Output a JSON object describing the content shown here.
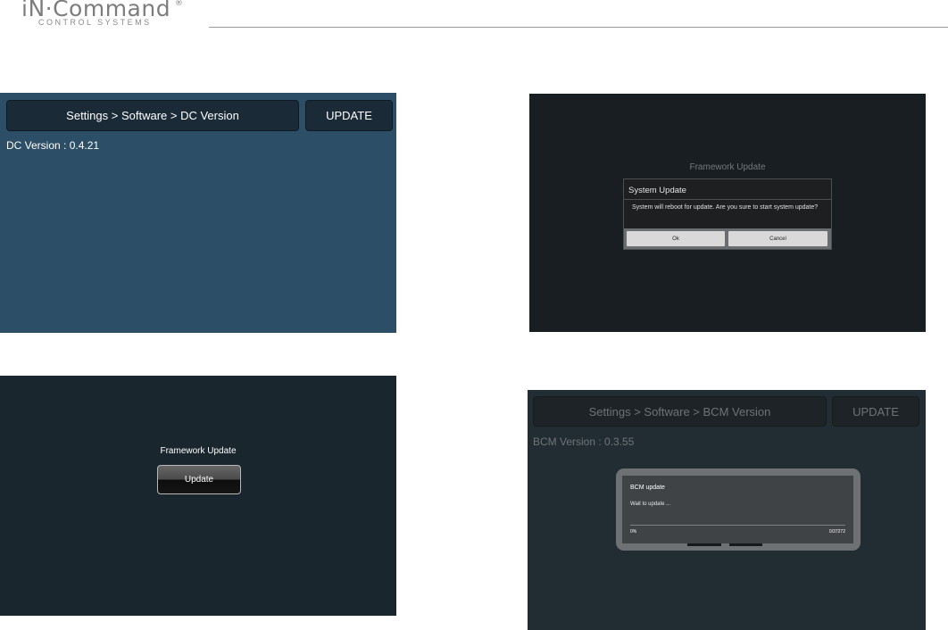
{
  "header": {
    "logo_main": "iN·Command",
    "logo_reg": "®",
    "logo_sub": "CONTROL SYSTEMS"
  },
  "screen_dc": {
    "breadcrumb": "Settings > Software > DC Version",
    "update_label": "UPDATE",
    "version_text": "DC Version : 0.4.21"
  },
  "screen_confirm": {
    "framework_title": "Framework Update",
    "dialog": {
      "title": "System Update",
      "message": "System will reboot for update. Are you sure to start system update?",
      "ok_label": "Ok",
      "cancel_label": "Cancel"
    }
  },
  "screen_framework": {
    "framework_title": "Framework Update",
    "update_label": "Update"
  },
  "screen_bcm": {
    "breadcrumb": "Settings > Software > BCM Version",
    "update_label": "UPDATE",
    "version_text": "BCM Version : 0.3.55",
    "progress": {
      "title": "BCM update",
      "message": "Wait to update ...",
      "percent_label": "0%",
      "count_label": "0/37272",
      "fraction": 0
    }
  }
}
